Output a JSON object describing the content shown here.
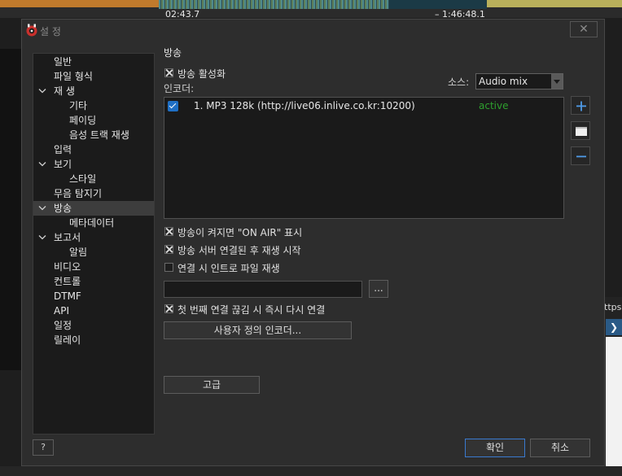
{
  "background": {
    "time_left": "02:43.7",
    "time_right": "– 1:46:48.1",
    "right_snippet": "ttps:/",
    "right_button": "❯"
  },
  "dialog": {
    "title": "설 정",
    "close_glyph": "✕",
    "nav": [
      {
        "label": "일반",
        "level": 0,
        "expand": false
      },
      {
        "label": "파일 형식",
        "level": 0,
        "expand": false
      },
      {
        "label": "재 생",
        "level": 0,
        "expand": true
      },
      {
        "label": "기타",
        "level": 1,
        "expand": false
      },
      {
        "label": "페이딩",
        "level": 1,
        "expand": false
      },
      {
        "label": "음성 트랙 재생",
        "level": 1,
        "expand": false
      },
      {
        "label": "입력",
        "level": 0,
        "expand": false
      },
      {
        "label": "보기",
        "level": 0,
        "expand": true
      },
      {
        "label": "스타일",
        "level": 1,
        "expand": false
      },
      {
        "label": "무음 탐지기",
        "level": 0,
        "expand": false
      },
      {
        "label": "방송",
        "level": 0,
        "expand": true,
        "selected": true
      },
      {
        "label": "메타데이터",
        "level": 1,
        "expand": false
      },
      {
        "label": "보고서",
        "level": 0,
        "expand": true
      },
      {
        "label": "알림",
        "level": 1,
        "expand": false
      },
      {
        "label": "비디오",
        "level": 0,
        "expand": false
      },
      {
        "label": "컨트롤",
        "level": 0,
        "expand": false
      },
      {
        "label": "DTMF",
        "level": 0,
        "expand": false
      },
      {
        "label": "API",
        "level": 0,
        "expand": false
      },
      {
        "label": "일정",
        "level": 0,
        "expand": false
      },
      {
        "label": "릴레이",
        "level": 0,
        "expand": false
      }
    ],
    "section_title": "방송",
    "enable_broadcast": {
      "label": "방송 활성화",
      "checked": true
    },
    "encoder_label": "인코더:",
    "source": {
      "label": "소스:",
      "value": "Audio mix"
    },
    "encoders": [
      {
        "name": "1. MP3 128k (http://live06.inlive.co.kr:10200)",
        "status": "active",
        "checked": true
      }
    ],
    "side_buttons": {
      "add": "add-icon",
      "edit": "edit-icon",
      "remove": "remove-icon"
    },
    "options": [
      {
        "label": "방송이 켜지면 \"ON AIR\" 표시",
        "checked": true
      },
      {
        "label": "방송 서버 연결된 후 재생 시작",
        "checked": true
      },
      {
        "label": "연결 시 인트로 파일 재생",
        "checked": false
      }
    ],
    "intro_path": {
      "value": "",
      "browse_label": "..."
    },
    "reconnect": {
      "label": "첫 번째 연결 끊김 시 즉시 다시 연결",
      "checked": true
    },
    "custom_encoder_label": "사용자 정의 인코더...",
    "advanced_label": "고급",
    "help_label": "?",
    "ok_label": "확인",
    "cancel_label": "취소",
    "colors": {
      "active_status": "#2ea02e",
      "accent_blue": "#1f6fc4"
    }
  }
}
